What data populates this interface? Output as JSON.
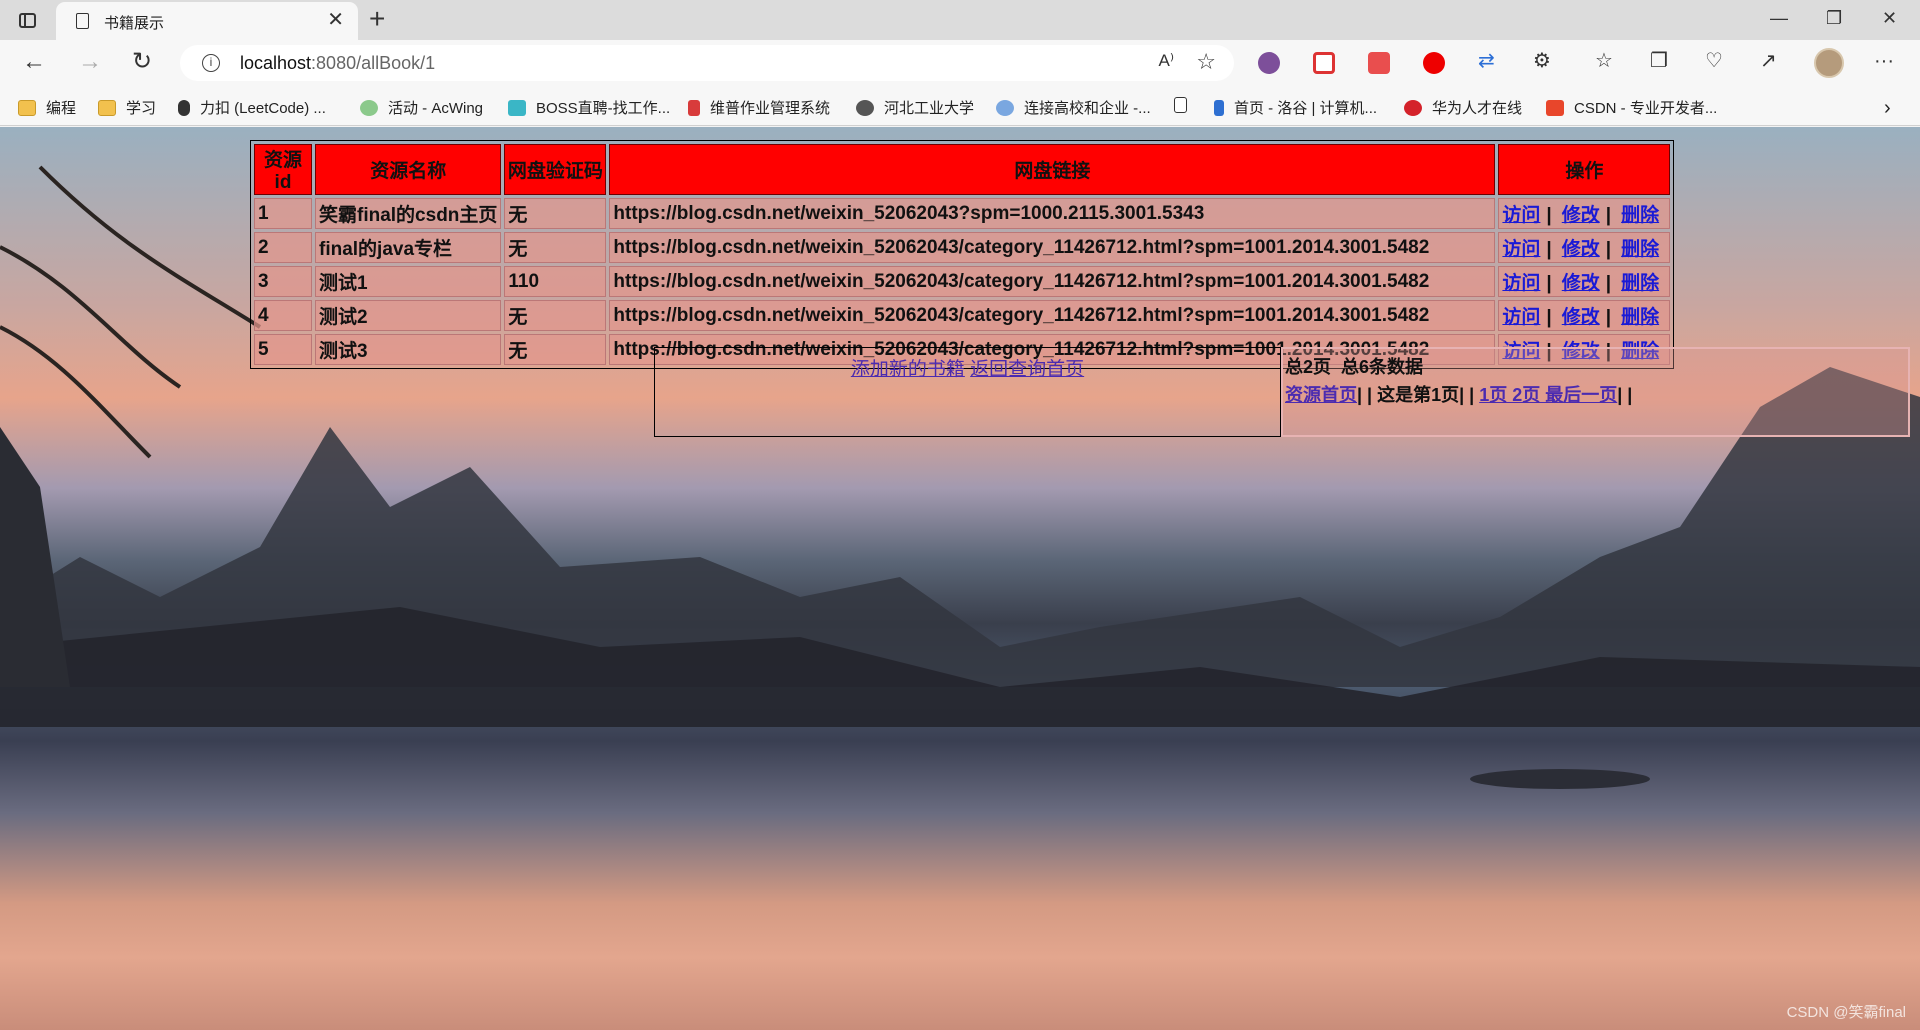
{
  "browser": {
    "tab_title": "书籍展示",
    "url_host": "localhost",
    "url_rest": ":8080/allBook/1",
    "bookmarks": [
      {
        "label": "编程",
        "icon": "folder-icon"
      },
      {
        "label": "学习",
        "icon": "folder-icon"
      },
      {
        "label": "力扣 (LeetCode) ...",
        "icon": "leetcode-icon"
      },
      {
        "label": "活动 - AcWing",
        "icon": "acwing-icon"
      },
      {
        "label": "BOSS直聘-找工作...",
        "icon": "boss-icon"
      },
      {
        "label": "维普作业管理系统",
        "icon": "weipu-icon"
      },
      {
        "label": "河北工业大学",
        "icon": "globe-icon"
      },
      {
        "label": "连接高校和企业 -...",
        "icon": "link-icon"
      },
      {
        "label": "",
        "icon": "page-icon"
      },
      {
        "label": "首页 - 洛谷 | 计算机...",
        "icon": "luogu-icon"
      },
      {
        "label": "华为人才在线",
        "icon": "huawei-icon"
      },
      {
        "label": "CSDN - 专业开发者...",
        "icon": "csdn-icon"
      }
    ]
  },
  "table": {
    "headers": [
      "资源id",
      "资源名称",
      "网盘验证码",
      "网盘链接",
      "操作"
    ],
    "rows": [
      {
        "id": "1",
        "name": "笑霸final的csdn主页",
        "code": "无",
        "link": "https://blog.csdn.net/weixin_52062043?spm=1000.2115.3001.5343"
      },
      {
        "id": "2",
        "name": "final的java专栏",
        "code": "无",
        "link": "https://blog.csdn.net/weixin_52062043/category_11426712.html?spm=1001.2014.3001.5482"
      },
      {
        "id": "3",
        "name": "测试1",
        "code": "110",
        "link": "https://blog.csdn.net/weixin_52062043/category_11426712.html?spm=1001.2014.3001.5482"
      },
      {
        "id": "4",
        "name": "测试2",
        "code": "无",
        "link": "https://blog.csdn.net/weixin_52062043/category_11426712.html?spm=1001.2014.3001.5482"
      },
      {
        "id": "5",
        "name": "测试3",
        "code": "无",
        "link": "https://blog.csdn.net/weixin_52062043/category_11426712.html?spm=1001.2014.3001.5482"
      }
    ],
    "actions": {
      "visit": "访问",
      "edit": "修改",
      "delete": "删除",
      "sep": "|"
    }
  },
  "links": {
    "add_book": "添加新的书籍",
    "back_query": "返回查询首页"
  },
  "pagination": {
    "summary": "总2页  总6条数据",
    "first": "资源首页",
    "current": "| | 这是第1页| |",
    "pages": "1页 2页 最后一页",
    "tail": "| |"
  },
  "watermark": "CSDN @笑霸final"
}
